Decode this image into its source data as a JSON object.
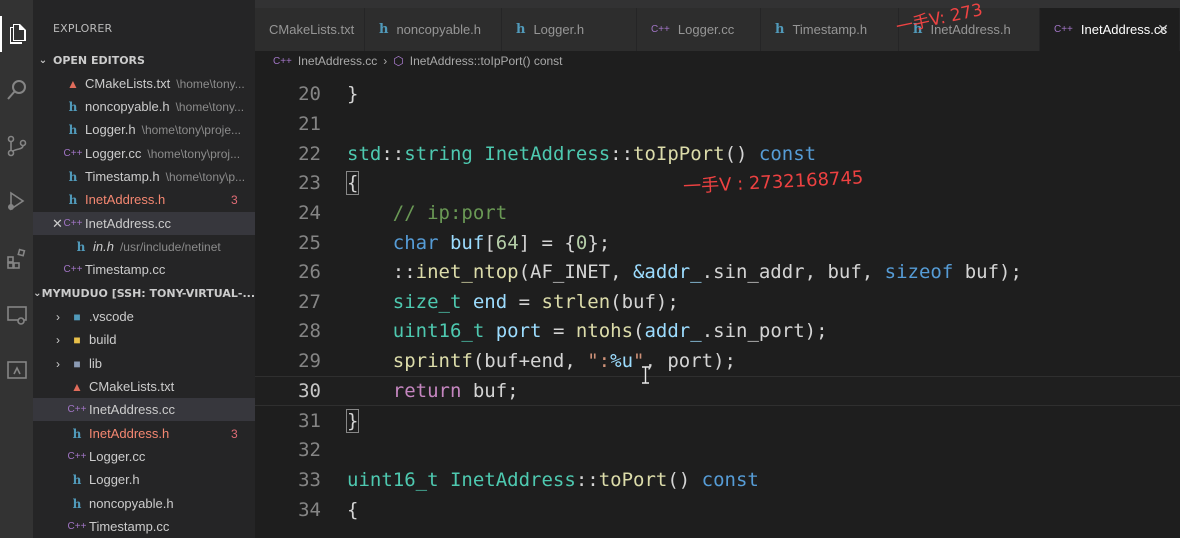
{
  "sidebar": {
    "title": "EXPLORER",
    "open_editors_header": "OPEN EDITORS",
    "open_editors": [
      {
        "name": "CMakeLists.txt",
        "path": "\\home\\tony...",
        "icon": "cmake-icon"
      },
      {
        "name": "noncopyable.h",
        "path": "\\home\\tony...",
        "icon": "c-header-icon"
      },
      {
        "name": "Logger.h",
        "path": "\\home\\tony\\proje...",
        "icon": "c-header-icon"
      },
      {
        "name": "Logger.cc",
        "path": "\\home\\tony\\proj...",
        "icon": "cpp-icon"
      },
      {
        "name": "Timestamp.h",
        "path": "\\home\\tony\\p...",
        "icon": "c-header-icon"
      },
      {
        "name": "InetAddress.h",
        "path": "",
        "badge": "3",
        "icon": "c-header-icon"
      },
      {
        "name": "InetAddress.cc",
        "path": "",
        "icon": "cpp-icon"
      },
      {
        "name": "in.h",
        "path": "/usr/include/netinet",
        "icon": "c-header-icon"
      },
      {
        "name": "Timestamp.cc",
        "path": "",
        "icon": "cpp-icon"
      }
    ],
    "workspace_header": "MYMUDUO [SSH: TONY-VIRTUAL-...",
    "workspace_items": [
      {
        "name": ".vscode",
        "type": "folder"
      },
      {
        "name": "build",
        "type": "folder"
      },
      {
        "name": "lib",
        "type": "folder"
      },
      {
        "name": "CMakeLists.txt",
        "type": "file"
      },
      {
        "name": "InetAddress.cc",
        "type": "file"
      },
      {
        "name": "InetAddress.h",
        "type": "file",
        "badge": "3"
      },
      {
        "name": "Logger.cc",
        "type": "file"
      },
      {
        "name": "Logger.h",
        "type": "file"
      },
      {
        "name": "noncopyable.h",
        "type": "file"
      },
      {
        "name": "Timestamp.cc",
        "type": "file"
      }
    ]
  },
  "tabs": [
    {
      "label": "CMakeLists.txt",
      "icon": "cmake-icon"
    },
    {
      "label": "noncopyable.h",
      "icon": "c-header-icon"
    },
    {
      "label": "Logger.h",
      "icon": "c-header-icon"
    },
    {
      "label": "Logger.cc",
      "icon": "cpp-icon"
    },
    {
      "label": "Timestamp.h",
      "icon": "c-header-icon"
    },
    {
      "label": "InetAddress.h",
      "icon": "c-header-icon"
    },
    {
      "label": "InetAddress.cc",
      "icon": "cpp-icon",
      "active": true
    }
  ],
  "breadcrumbs": {
    "file": "InetAddress.cc",
    "symbol": "InetAddress::toIpPort() const"
  },
  "editor": {
    "line_numbers": [
      "20",
      "21",
      "22",
      "23",
      "24",
      "25",
      "26",
      "27",
      "28",
      "29",
      "30",
      "31",
      "32",
      "33",
      "34"
    ],
    "current_line": "30",
    "lines_text": [
      "}",
      "",
      "std::string InetAddress::toIpPort() const",
      "{",
      "    // ip:port",
      "    char buf[64] = {0};",
      "    ::inet_ntop(AF_INET, &addr_.sin_addr, buf, sizeof buf);",
      "    size_t end = strlen(buf);",
      "    uint16_t port = ntohs(addr_.sin_port);",
      "    sprintf(buf+end, \":%u\", port);",
      "    return buf;",
      "}",
      "",
      "uint16_t InetAddress::toPort() const",
      "{"
    ]
  },
  "watermarks": {
    "code_overlay": "一手V : 2732168745",
    "tab_overlay": "一手V: 273"
  },
  "colors": {
    "keyword": "#569cd6",
    "type": "#4ec9b0",
    "function": "#dcdcaa",
    "number": "#b5cea8",
    "string": "#ce9178",
    "variable": "#9cdcfe",
    "comment": "#6a9955",
    "control": "#c586c0",
    "error_file": "#f48771"
  }
}
